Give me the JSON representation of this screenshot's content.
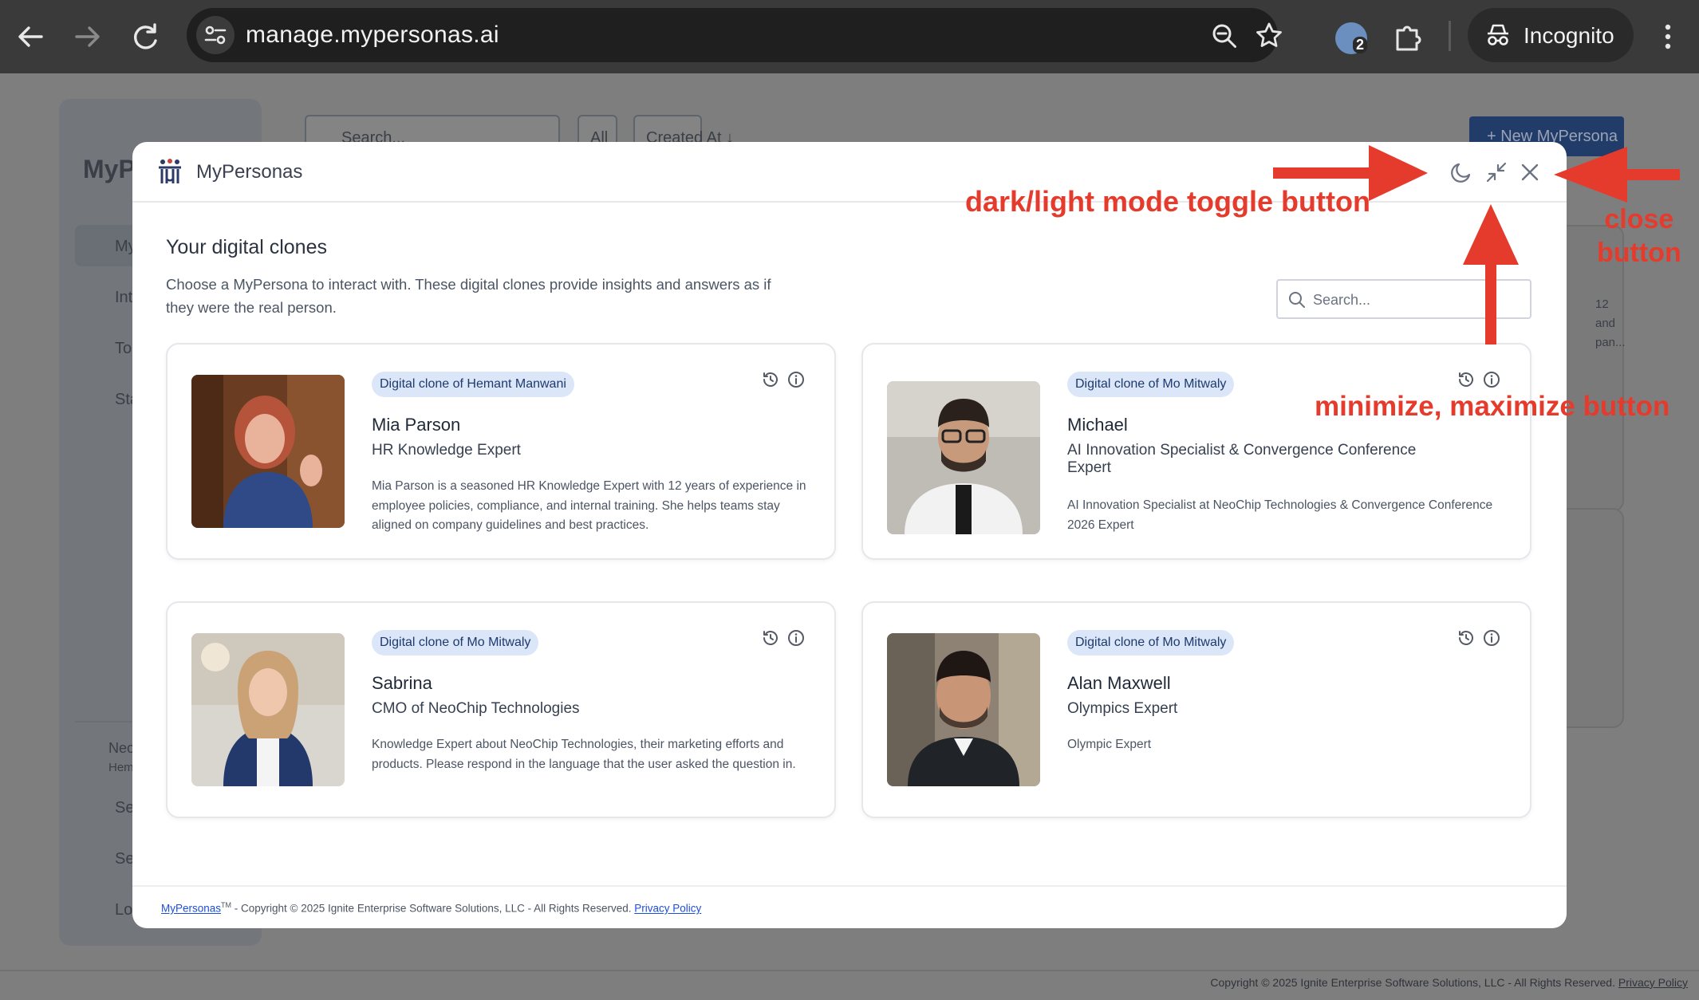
{
  "browser": {
    "url": "manage.mypersonas.ai",
    "extension_badge": "2",
    "profile_label": "Incognito"
  },
  "background_app": {
    "brand_fragment": "MyP",
    "nav_fragments": [
      "My",
      "Int",
      "Too",
      "Sta"
    ],
    "bottom_fragments": [
      "Neo",
      "Hem",
      "Set",
      "Ser",
      "Log"
    ],
    "search_placeholder": "Search...",
    "filter_all": "All",
    "sort_label": "Created At ↓",
    "new_button": "+ New MyPersona",
    "right_snippets": [
      "12",
      "and",
      "pan..."
    ],
    "footer": "Copyright © 2025 Ignite Enterprise Software Solutions, LLC - All Rights Reserved.",
    "footer_link": "Privacy Policy"
  },
  "modal": {
    "brand": "MyPersonas",
    "title": "Your digital clones",
    "description": "Choose a MyPersona to interact with. These digital clones provide insights and answers as if they were the real person.",
    "search_placeholder": "Search...",
    "cards": [
      {
        "tag": "Digital clone of Hemant Manwani",
        "name": "Mia Parson",
        "role": "HR Knowledge Expert",
        "description": "Mia Parson is a seasoned HR Knowledge Expert with 12 years of experience in employee policies, compliance, and internal training. She helps teams stay aligned on company guidelines and best practices."
      },
      {
        "tag": "Digital clone of Mo Mitwaly",
        "name": "Michael",
        "role": "AI Innovation Specialist & Convergence Conference Expert",
        "description": "AI Innovation Specialist at NeoChip Technologies & Convergence Conference 2026 Expert"
      },
      {
        "tag": "Digital clone of Mo Mitwaly",
        "name": "Sabrina",
        "role": "CMO of NeoChip Technologies",
        "description": "Knowledge Expert about NeoChip Technologies, their marketing efforts and products. Please respond in the language that the user asked the question in."
      },
      {
        "tag": "Digital clone of Mo Mitwaly",
        "name": "Alan Maxwell",
        "role": "Olympics Expert",
        "description": "Olympic Expert"
      }
    ],
    "footer": {
      "brand_link": "MyPersonas",
      "trademark": "TM",
      "copyright": " - Copyright © 2025 Ignite Enterprise Software Solutions, LLC - All Rights Reserved. ",
      "privacy_link": "Privacy Policy"
    }
  },
  "annotations": {
    "toggle": "dark/light mode toggle button",
    "close_line1": "close",
    "close_line2": "button",
    "minmax": "minimize, maximize button",
    "color": "#e53b2c"
  }
}
